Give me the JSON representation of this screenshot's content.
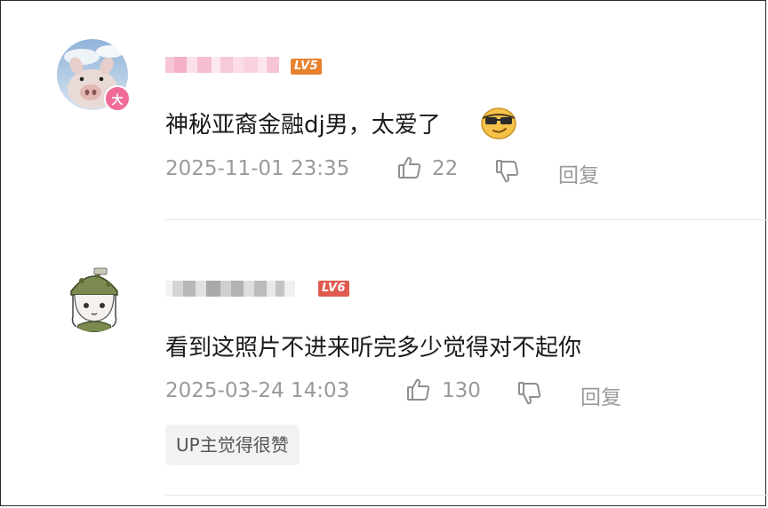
{
  "comments": [
    {
      "username_redacted": true,
      "level": "LV5",
      "level_color": "#e8822f",
      "vip_badge": "大",
      "text": "神秘亚裔金融dj男，太爱了",
      "emoji": "sunglasses-emoji",
      "timestamp": "2025-11-01 23:35",
      "likes": "22",
      "reply_label": "回复"
    },
    {
      "username_redacted": true,
      "level": "LV6",
      "level_color": "#e05a4f",
      "text": "看到这照片不进来听完多少觉得对不起你",
      "timestamp": "2025-03-24 14:03",
      "likes": "130",
      "reply_label": "回复",
      "tag": "UP主觉得很赞"
    }
  ],
  "colors": {
    "meta_text": "#9a9a9a",
    "body_text": "#1a1a1a",
    "divider": "#e6e6e6",
    "vip_pink": "#f06c97"
  }
}
